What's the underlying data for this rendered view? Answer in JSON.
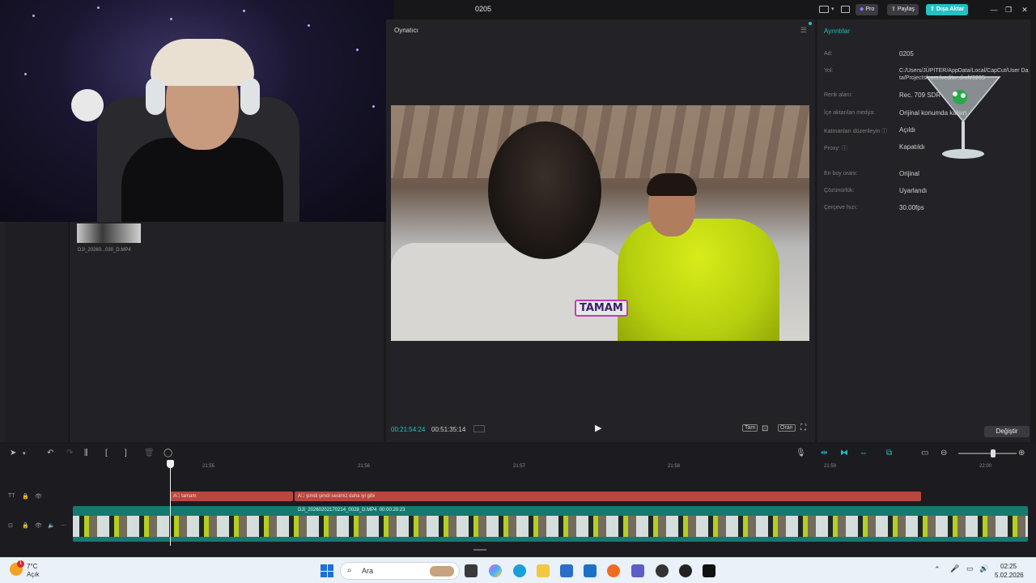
{
  "titlebar": {
    "title": "0205",
    "pro_label": "Pro",
    "share_label": "Paylaş",
    "export_label": "Dışa Aktar"
  },
  "media": {
    "clip_name": "DJI_20260...030_D.MP4"
  },
  "player": {
    "title": "Oynatıcı",
    "subtitle_text": "TAMAM",
    "current_time": "00:21:54:24",
    "total_time": "00:51:35:14",
    "full_label": "Tam",
    "ratio_label": "Oran"
  },
  "details": {
    "title": "Ayrıntılar",
    "rows": [
      {
        "label": "Ad:",
        "value": "0205"
      },
      {
        "label": "Yol:",
        "value": "C:/Users/JÜPİTER/AppData/Local/CapCut/User Data/Projects/com.lveditor.draft/0205"
      },
      {
        "label": "Renk alanı:",
        "value": "Rec. 709 SDR"
      },
      {
        "label": "İçe aktarılan medya:",
        "value": "Orijinal konumda kalsın"
      },
      {
        "label": "Katmanları düzenleyin ⓘ",
        "value": "Açıldı"
      },
      {
        "label": "Proxy: ⓘ",
        "value": "Kapatıldı"
      },
      {
        "label": "En boy oranı:",
        "value": "Orijinal"
      },
      {
        "label": "Çözünürlük:",
        "value": "Uyarlandı"
      },
      {
        "label": "Çerçeve hızı:",
        "value": "30.00fps"
      }
    ],
    "change_label": "Değiştir"
  },
  "timeline": {
    "ticks": [
      "21:55",
      "21:56",
      "21:57",
      "21:58",
      "21:59",
      "22:00"
    ],
    "text_clips": [
      "tamam",
      "şimdi şimdi sesimiz daha iyi gibi"
    ],
    "video_clip": {
      "name": "DJI_20260202170214_0028_D.MP4",
      "duration": "00:00:20:23"
    }
  },
  "taskbar": {
    "weather_temp": "7°C",
    "weather_cond": "Açık",
    "weather_badge": "1",
    "search_placeholder": "Ara",
    "time": "02:25",
    "date": "5.02.2026"
  },
  "colors": {
    "accent": "#22c1c3",
    "text_clip": "#b9473f",
    "video_track": "#16796f"
  }
}
